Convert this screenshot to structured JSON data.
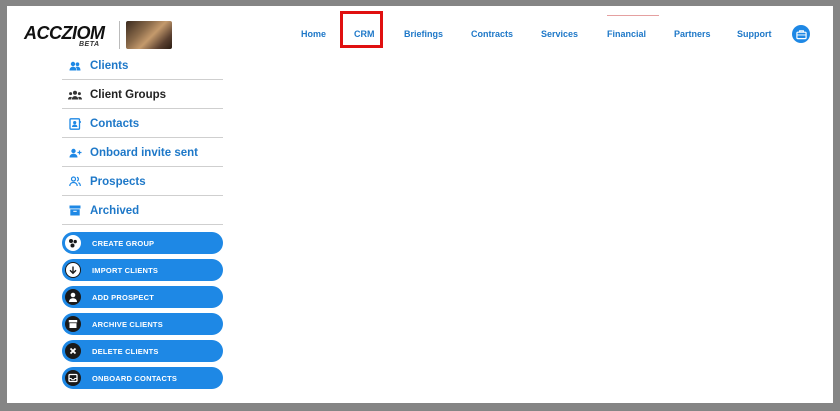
{
  "brand": {
    "name": "ACCZIOM",
    "tag": "BETA"
  },
  "nav": {
    "items": [
      {
        "label": "Home"
      },
      {
        "label": "CRM"
      },
      {
        "label": "Briefings"
      },
      {
        "label": "Contracts"
      },
      {
        "label": "Services"
      },
      {
        "label": "Financial"
      },
      {
        "label": "Partners"
      },
      {
        "label": "Support"
      }
    ],
    "highlight": "CRM",
    "accent": "#1e78c8"
  },
  "sidebar": {
    "items": [
      {
        "label": "Clients",
        "icon": "users-icon"
      },
      {
        "label": "Client Groups",
        "icon": "group-icon",
        "active": true
      },
      {
        "label": "Contacts",
        "icon": "contact-card-icon"
      },
      {
        "label": "Onboard invite sent",
        "icon": "user-add-icon"
      },
      {
        "label": "Prospects",
        "icon": "prospect-icon"
      },
      {
        "label": "Archived",
        "icon": "archive-icon"
      }
    ],
    "actions": [
      {
        "label": "CREATE GROUP",
        "icon": "group-circle-icon"
      },
      {
        "label": "IMPORT CLIENTS",
        "icon": "download-icon"
      },
      {
        "label": "ADD PROSPECT",
        "icon": "person-icon"
      },
      {
        "label": "ARCHIVE CLIENTS",
        "icon": "archive-icon"
      },
      {
        "label": "DELETE CLIENTS",
        "icon": "close-icon"
      },
      {
        "label": "ONBOARD CONTACTS",
        "icon": "inbox-icon"
      }
    ]
  },
  "colors": {
    "primary": "#1e88e5",
    "highlight_border": "#e01010"
  }
}
